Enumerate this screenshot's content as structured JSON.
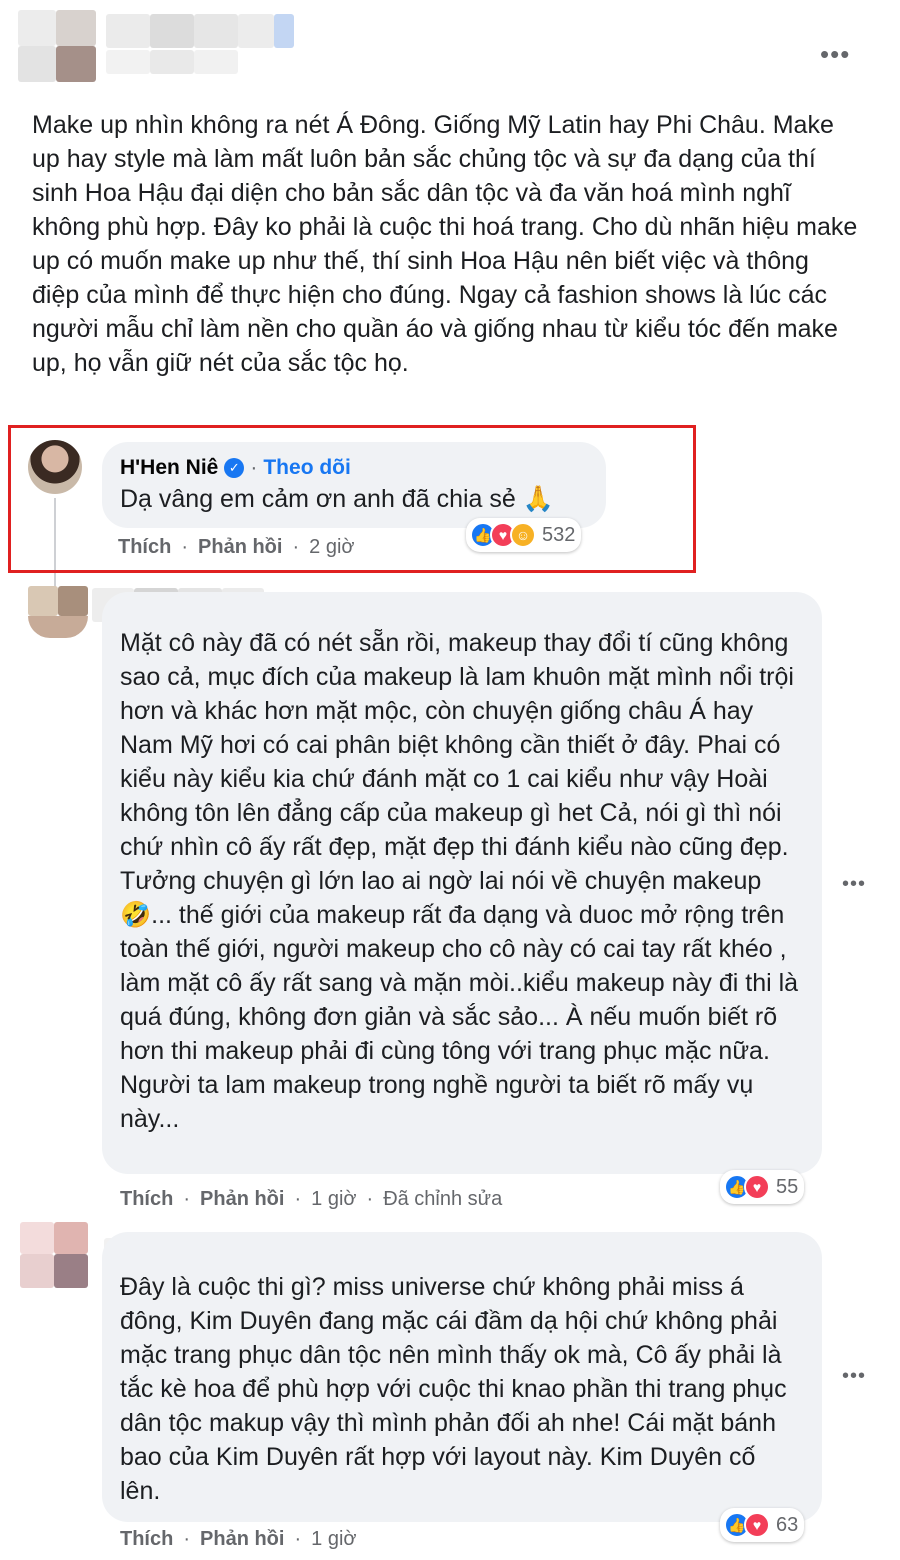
{
  "post": {
    "more_glyph": "•••",
    "text": "Make up nhìn không ra nét Á Đông. Giống Mỹ Latin hay Phi Châu. Make up hay style mà làm mất luôn bản sắc chủng tộc và sự đa dạng của thí sinh Hoa Hậu đại diện cho bản sắc dân tộc và đa văn hoá mình nghĩ không phù hợp. Đây ko phải là cuộc thi hoá trang. Cho dù nhãn hiệu make up có muốn make up như thế, thí sinh Hoa Hậu nên biết việc và thông điệp của mình để thực hiện cho đúng. Ngay cả fashion shows là lúc các người mẫu chỉ làm nền cho quần áo và giống nhau từ kiểu tóc đến make up, họ vẫn giữ nét của sắc tộc họ."
  },
  "comments": [
    {
      "author": "H'Hen Niê",
      "verified_glyph": "✓",
      "dot": "·",
      "follow": "Theo dõi",
      "text": "Dạ vâng em cảm ơn anh đã chia sẻ 🙏",
      "like": "Thích",
      "reply": "Phản hồi",
      "time": "2 giờ",
      "reaction_count": "532",
      "reactions": [
        "like-icon",
        "love-icon",
        "care-icon"
      ]
    },
    {
      "text": "Mặt cô này đã có nét sẵn rồi, makeup thay đổi tí cũng không sao cả, mục đích của makeup là lam khuôn mặt mình nổi trội hơn và khác hơn mặt mộc, còn chuyện giống châu Á hay Nam Mỹ hơi có cai phân biệt không cần thiết ở đây. Phai có kiểu này kiểu kia chứ đánh mặt co 1 cai kiểu như vậy Hoài không tôn lên đẳng cấp của makeup gì het Cả, nói gì thì nói chứ nhìn cô ấy rất đẹp, mặt đẹp thi đánh kiểu nào cũng đẹp. Tưởng chuyện gì lớn lao ai ngờ lai nói về chuyện makeup 🤣... thế giới của makeup rất đa dạng và duoc mở rộng trên toàn thế giới, người makeup cho cô này có cai tay rất khéo , làm mặt cô ấy rất sang và mặn mòi..kiểu makeup này đi thi là quá đúng, không đơn giản và sắc sảo... À nếu muốn biết rõ hơn thi makeup phải đi cùng tông với trang phục mặc nữa. Người ta lam makeup trong nghề người ta biết rõ mấy vụ này...",
      "like": "Thích",
      "reply": "Phản hồi",
      "time": "1 giờ",
      "dot": "·",
      "edited": "Đã chỉnh sửa",
      "reaction_count": "55",
      "more_glyph": "•••",
      "reactions": [
        "like-icon",
        "love-icon"
      ]
    },
    {
      "text": "Đây là cuộc thi gì? miss universe chứ không phải miss á đông, Kim Duyên đang mặc cái đầm dạ hội chứ không phải mặc trang phục dân tộc nên mình thấy ok mà, Cô ấy phải là tắc kè hoa để phù hợp với cuộc thi knao phần thi trang phục dân tộc makup vậy thì mình phản đối ah nhe! Cái mặt bánh bao của Kim Duyên rất hợp với layout này. Kim Duyên cố lên.",
      "like": "Thích",
      "reply": "Phản hồi",
      "time": "1 giờ",
      "reaction_count": "63",
      "more_glyph": "•••",
      "reactions": [
        "like-icon",
        "love-icon"
      ]
    }
  ],
  "colors": {
    "accent": "#1877f2",
    "highlight": "#e02020",
    "bubble": "#f0f2f5",
    "secondary_text": "#65676b"
  }
}
